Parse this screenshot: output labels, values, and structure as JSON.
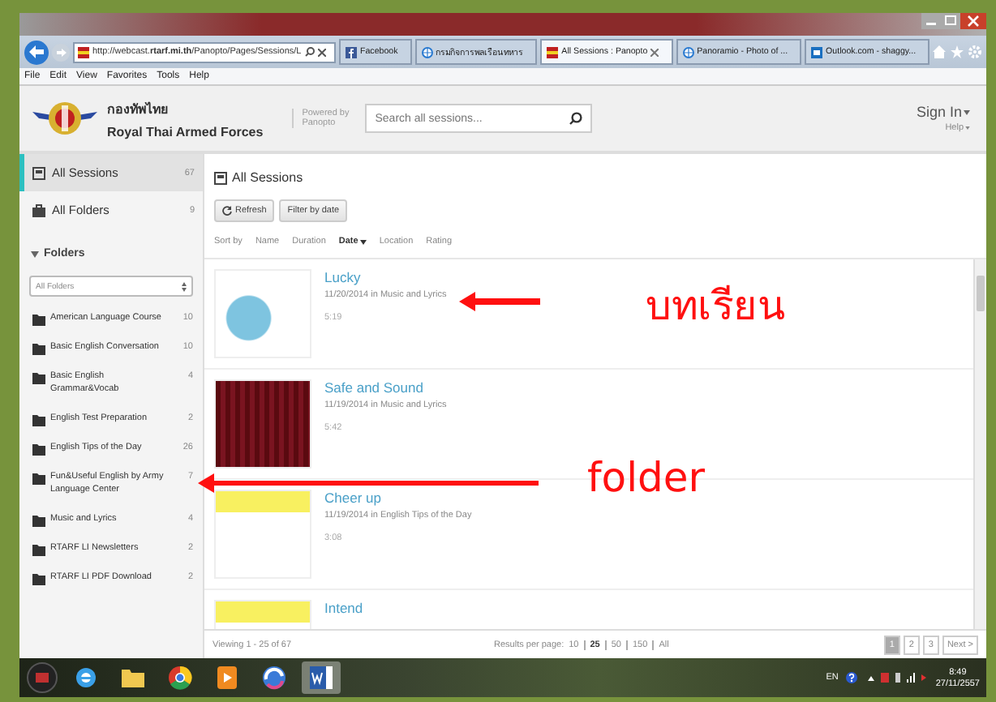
{
  "browser": {
    "address": "http://webcast.**rtarf.mi.th**/Panopto/Pages/Sessions/L",
    "tabs": [
      {
        "label": "Facebook",
        "kind": "facebook",
        "selected": false
      },
      {
        "label": "กรมกิจการพลเรือนทหาร",
        "kind": "globe",
        "selected": false
      },
      {
        "label": "All Sessions : Panopto",
        "kind": "panopto",
        "selected": true
      },
      {
        "label": "Panoramio - Photo of ...",
        "kind": "globe",
        "selected": false
      },
      {
        "label": "Outlook.com - shaggy...",
        "kind": "outlook",
        "selected": false
      }
    ]
  },
  "menu_bar": [
    "File",
    "Edit",
    "View",
    "Favorites",
    "Tools",
    "Help"
  ],
  "header": {
    "org_thai": "กองทัพไทย",
    "org_english": "Royal Thai Armed Forces",
    "powered_by": [
      "Powered by",
      "Panopto"
    ],
    "search": {
      "placeholder": "Search all sessions..."
    },
    "sign_in": "Sign In",
    "help": "Help"
  },
  "sidebar": {
    "nav": [
      {
        "label": "All Sessions",
        "count": "67",
        "kind": "sessions",
        "selected": true
      },
      {
        "label": "All Folders",
        "count": "9",
        "kind": "folders",
        "selected": false
      }
    ],
    "folders_heading": "Folders",
    "folders_expanded": true,
    "folder_filter": "All Folders",
    "folders": [
      {
        "name": "American Language Course",
        "count": "10"
      },
      {
        "name": "Basic English Conversation",
        "count": "10"
      },
      {
        "name": "Basic English Grammar&Vocab",
        "count": "4"
      },
      {
        "name": "English Test Preparation",
        "count": "2"
      },
      {
        "name": "English Tips of the Day",
        "count": "26"
      },
      {
        "name": "Fun&Useful English by Army Language Center",
        "count": "7"
      },
      {
        "name": "Music and Lyrics",
        "count": "4"
      },
      {
        "name": "RTARF LI Newsletters",
        "count": "2"
      },
      {
        "name": "RTARF LI PDF Download",
        "count": "2"
      }
    ]
  },
  "main": {
    "title": "All Sessions",
    "buttons": [
      {
        "label": "Refresh",
        "kind": "refresh"
      },
      {
        "label": "Filter by date",
        "kind": "plain"
      }
    ],
    "sort_label": "Sort by",
    "sort_options": [
      {
        "label": "Name",
        "selected": false
      },
      {
        "label": "Duration",
        "selected": false
      },
      {
        "label": "Date",
        "selected": true
      },
      {
        "label": "Location",
        "selected": false
      },
      {
        "label": "Rating",
        "selected": false
      }
    ],
    "sessions": [
      {
        "title": "Lucky",
        "meta": "11/20/2014 in Music and Lyrics",
        "duration": "5:19",
        "kind": "music"
      },
      {
        "title": "Safe and Sound",
        "meta": "11/19/2014 in Music and Lyrics",
        "duration": "5:42",
        "kind": "curtain"
      },
      {
        "title": "Cheer up",
        "meta": "11/19/2014 in English Tips of the Day",
        "duration": "3:08",
        "kind": "tips"
      },
      {
        "title": "Intend",
        "kind": "tips"
      }
    ]
  },
  "footer": {
    "viewing": "Viewing 1 - 25 of 67",
    "per_page_label": "Results per page:",
    "per_page": [
      {
        "label": "10",
        "selected": false
      },
      {
        "label": "25",
        "selected": true
      },
      {
        "label": "50",
        "selected": false
      },
      {
        "label": "150",
        "selected": false
      },
      {
        "label": "All",
        "selected": false
      }
    ],
    "pages": [
      {
        "label": "1",
        "selected": true
      },
      {
        "label": "2",
        "selected": false
      },
      {
        "label": "3",
        "selected": false
      }
    ],
    "next": "Next >"
  },
  "taskbar": {
    "apps": [
      {
        "kind": "ie",
        "active": false
      },
      {
        "kind": "explorer",
        "active": false
      },
      {
        "kind": "chrome",
        "active": false
      },
      {
        "kind": "media",
        "active": false
      },
      {
        "kind": "swirl",
        "active": false
      },
      {
        "kind": "word",
        "active": true
      }
    ],
    "language": "EN",
    "time": "8:49",
    "date": "27/11/2557"
  },
  "annotations": [
    {
      "text": "บทเรียน",
      "kind": "session"
    },
    {
      "text": "folder",
      "kind": "folder"
    }
  ]
}
